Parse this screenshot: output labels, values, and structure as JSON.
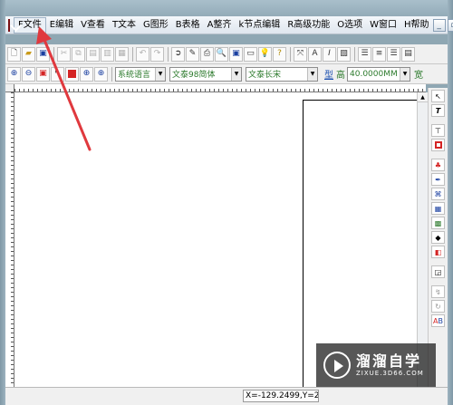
{
  "menu": {
    "items": [
      {
        "label": "F文件",
        "name": "menu-file"
      },
      {
        "label": "E编辑",
        "name": "menu-edit"
      },
      {
        "label": "V查看",
        "name": "menu-view"
      },
      {
        "label": "T文本",
        "name": "menu-text"
      },
      {
        "label": "G图形",
        "name": "menu-graphics"
      },
      {
        "label": "B表格",
        "name": "menu-table"
      },
      {
        "label": "A整齐",
        "name": "menu-align"
      },
      {
        "label": "k节点编辑",
        "name": "menu-node-edit"
      },
      {
        "label": "R高级功能",
        "name": "menu-advanced"
      },
      {
        "label": "O选项",
        "name": "menu-options"
      },
      {
        "label": "W窗口",
        "name": "menu-window"
      },
      {
        "label": "H帮助",
        "name": "menu-help"
      }
    ]
  },
  "toolbar2": {
    "language_combo": "系统语言",
    "font_cn_combo": "文泰98简体",
    "font_en_combo": "文泰长宋",
    "type_label": "型",
    "height_label": "高",
    "height_value": "40.0000MM",
    "width_label": "宽"
  },
  "status": {
    "coordinates": "X=-129.2499,Y=2("
  },
  "watermark": {
    "brand": "溜溜自学",
    "url": "ZIXUE.3D66.COM"
  },
  "colors": {
    "annotation_arrow": "#e0393e",
    "accent_red": "#d42424"
  }
}
